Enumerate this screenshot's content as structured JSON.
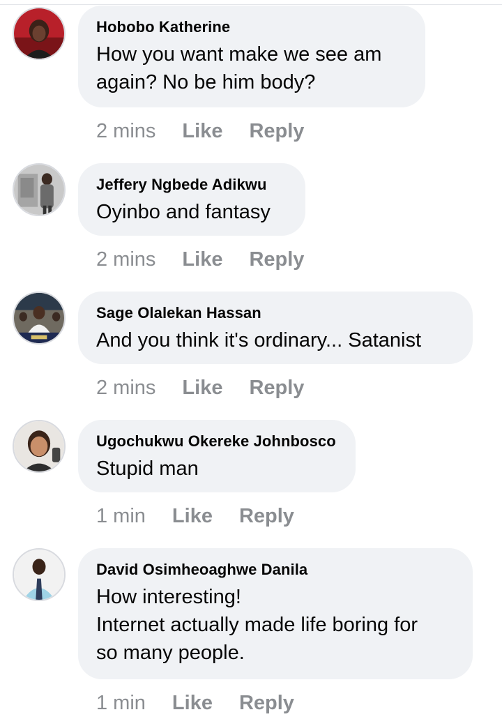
{
  "comments": [
    {
      "author": "Hobobo Katherine",
      "text": "How you want make we see am\nagain? No be him body?",
      "time": "2 mins",
      "like": "Like",
      "reply": "Reply"
    },
    {
      "author": "Jeffery Ngbede Adikwu",
      "text": "Oyinbo and fantasy",
      "time": "2 mins",
      "like": "Like",
      "reply": "Reply"
    },
    {
      "author": "Sage Olalekan Hassan",
      "text": "And you think it's ordinary... Satanist",
      "time": "2 mins",
      "like": "Like",
      "reply": "Reply"
    },
    {
      "author": "Ugochukwu Okereke Johnbosco",
      "text": "Stupid man",
      "time": "1 min",
      "like": "Like",
      "reply": "Reply"
    },
    {
      "author": "David Osimheoaghwe Danila",
      "text": "How interesting!\nInternet actually made life boring for\nso many people.",
      "time": "1 min",
      "like": "Like",
      "reply": "Reply"
    }
  ]
}
